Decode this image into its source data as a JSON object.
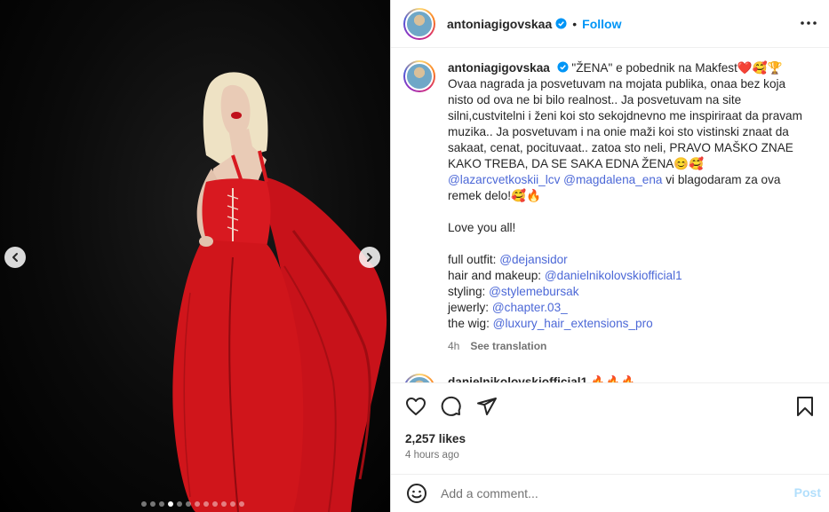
{
  "post": {
    "username": "antoniagigovskaa",
    "follow_label": "Follow",
    "separator": "•",
    "caption_lines": [
      "\"ŽENA\" e pobednik na Makfest❤️🥰🏆",
      "Ovaa nagrada ja posvetuvam na mojata publika, onaa bez koja nisto od ova ne bi bilo realnost.. Ja posvetuvam na site silni,custvitelni i ženi koi sto sekojdnevno me inspiriraat da pravam muzika.. Ja posvetuvam i na onie maži koi sto vistinski znaat da sakaat, cenat, pocituvaat.. zatoa sto neli, PRAVO MAŠKO ZNAE KAKO TREBA, DA SE SAKA EDNA ŽENA😊🥰"
    ],
    "thanks_mention_1": "@lazarcvetkoskii_lcv",
    "thanks_mention_2": "@magdalena_ena",
    "thanks_text": "vi blagodaram za ova remek delo!🥰🔥",
    "love": "Love you all!",
    "credits": [
      {
        "label": "full outfit:",
        "mention": "@dejansidor"
      },
      {
        "label": "hair and makeup:",
        "mention": "@danielnikolovskiofficial1"
      },
      {
        "label": "styling:",
        "mention": "@stylemebursak"
      },
      {
        "label": "jewerly:",
        "mention": "@chapter.03_"
      },
      {
        "label": "the wig:",
        "mention": "@luxury_hair_extensions_pro"
      }
    ],
    "age": "4h",
    "see_translation": "See translation",
    "next_comment_user": "danielnikolovskiofficial1",
    "next_comment_emoji": "🔥🔥🔥",
    "likes": "2,257 likes",
    "posted": "4 hours ago",
    "comment_placeholder": "Add a comment...",
    "post_label": "Post"
  },
  "carousel": {
    "total": 12,
    "active_index": 3
  },
  "colors": {
    "accent": "#0095f6",
    "mention": "#4c68d7",
    "dress": "#d0151b",
    "muted": "#737373"
  },
  "icons": [
    "verified-icon",
    "more-options-icon",
    "heart-icon",
    "comment-icon",
    "share-icon",
    "bookmark-icon",
    "emoji-icon",
    "chevron-left-icon",
    "chevron-right-icon"
  ]
}
